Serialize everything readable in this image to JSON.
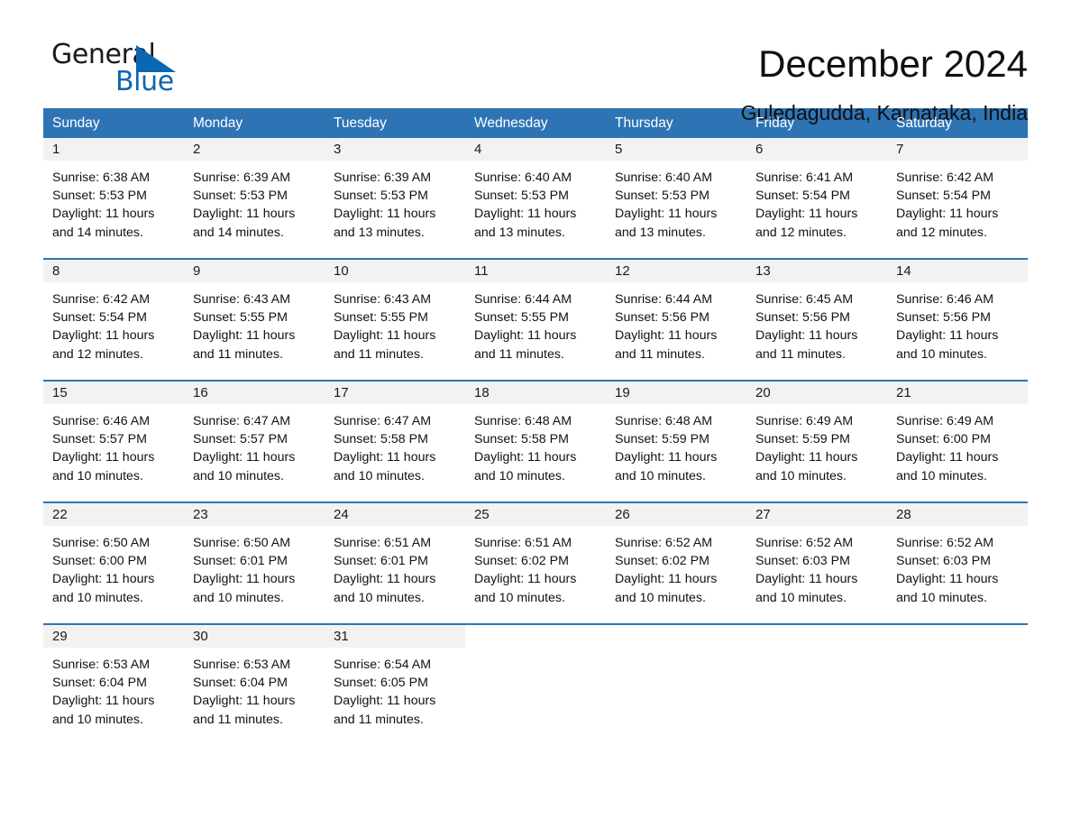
{
  "brand": {
    "name_part1": "General",
    "name_part2": "Blue",
    "accent_color": "#0b67b2",
    "triangle_icon": "triangle-icon"
  },
  "header": {
    "month_title": "December 2024",
    "location": "Guledagudda, Karnataka, India"
  },
  "calendar": {
    "header_bg": "#2e74b5",
    "daynum_band_bg": "#f2f2f2",
    "weekday_headers": [
      "Sunday",
      "Monday",
      "Tuesday",
      "Wednesday",
      "Thursday",
      "Friday",
      "Saturday"
    ],
    "weeks": [
      [
        {
          "day": "1",
          "sunrise": "Sunrise: 6:38 AM",
          "sunset": "Sunset: 5:53 PM",
          "daylight_line1": "Daylight: 11 hours",
          "daylight_line2": "and 14 minutes."
        },
        {
          "day": "2",
          "sunrise": "Sunrise: 6:39 AM",
          "sunset": "Sunset: 5:53 PM",
          "daylight_line1": "Daylight: 11 hours",
          "daylight_line2": "and 14 minutes."
        },
        {
          "day": "3",
          "sunrise": "Sunrise: 6:39 AM",
          "sunset": "Sunset: 5:53 PM",
          "daylight_line1": "Daylight: 11 hours",
          "daylight_line2": "and 13 minutes."
        },
        {
          "day": "4",
          "sunrise": "Sunrise: 6:40 AM",
          "sunset": "Sunset: 5:53 PM",
          "daylight_line1": "Daylight: 11 hours",
          "daylight_line2": "and 13 minutes."
        },
        {
          "day": "5",
          "sunrise": "Sunrise: 6:40 AM",
          "sunset": "Sunset: 5:53 PM",
          "daylight_line1": "Daylight: 11 hours",
          "daylight_line2": "and 13 minutes."
        },
        {
          "day": "6",
          "sunrise": "Sunrise: 6:41 AM",
          "sunset": "Sunset: 5:54 PM",
          "daylight_line1": "Daylight: 11 hours",
          "daylight_line2": "and 12 minutes."
        },
        {
          "day": "7",
          "sunrise": "Sunrise: 6:42 AM",
          "sunset": "Sunset: 5:54 PM",
          "daylight_line1": "Daylight: 11 hours",
          "daylight_line2": "and 12 minutes."
        }
      ],
      [
        {
          "day": "8",
          "sunrise": "Sunrise: 6:42 AM",
          "sunset": "Sunset: 5:54 PM",
          "daylight_line1": "Daylight: 11 hours",
          "daylight_line2": "and 12 minutes."
        },
        {
          "day": "9",
          "sunrise": "Sunrise: 6:43 AM",
          "sunset": "Sunset: 5:55 PM",
          "daylight_line1": "Daylight: 11 hours",
          "daylight_line2": "and 11 minutes."
        },
        {
          "day": "10",
          "sunrise": "Sunrise: 6:43 AM",
          "sunset": "Sunset: 5:55 PM",
          "daylight_line1": "Daylight: 11 hours",
          "daylight_line2": "and 11 minutes."
        },
        {
          "day": "11",
          "sunrise": "Sunrise: 6:44 AM",
          "sunset": "Sunset: 5:55 PM",
          "daylight_line1": "Daylight: 11 hours",
          "daylight_line2": "and 11 minutes."
        },
        {
          "day": "12",
          "sunrise": "Sunrise: 6:44 AM",
          "sunset": "Sunset: 5:56 PM",
          "daylight_line1": "Daylight: 11 hours",
          "daylight_line2": "and 11 minutes."
        },
        {
          "day": "13",
          "sunrise": "Sunrise: 6:45 AM",
          "sunset": "Sunset: 5:56 PM",
          "daylight_line1": "Daylight: 11 hours",
          "daylight_line2": "and 11 minutes."
        },
        {
          "day": "14",
          "sunrise": "Sunrise: 6:46 AM",
          "sunset": "Sunset: 5:56 PM",
          "daylight_line1": "Daylight: 11 hours",
          "daylight_line2": "and 10 minutes."
        }
      ],
      [
        {
          "day": "15",
          "sunrise": "Sunrise: 6:46 AM",
          "sunset": "Sunset: 5:57 PM",
          "daylight_line1": "Daylight: 11 hours",
          "daylight_line2": "and 10 minutes."
        },
        {
          "day": "16",
          "sunrise": "Sunrise: 6:47 AM",
          "sunset": "Sunset: 5:57 PM",
          "daylight_line1": "Daylight: 11 hours",
          "daylight_line2": "and 10 minutes."
        },
        {
          "day": "17",
          "sunrise": "Sunrise: 6:47 AM",
          "sunset": "Sunset: 5:58 PM",
          "daylight_line1": "Daylight: 11 hours",
          "daylight_line2": "and 10 minutes."
        },
        {
          "day": "18",
          "sunrise": "Sunrise: 6:48 AM",
          "sunset": "Sunset: 5:58 PM",
          "daylight_line1": "Daylight: 11 hours",
          "daylight_line2": "and 10 minutes."
        },
        {
          "day": "19",
          "sunrise": "Sunrise: 6:48 AM",
          "sunset": "Sunset: 5:59 PM",
          "daylight_line1": "Daylight: 11 hours",
          "daylight_line2": "and 10 minutes."
        },
        {
          "day": "20",
          "sunrise": "Sunrise: 6:49 AM",
          "sunset": "Sunset: 5:59 PM",
          "daylight_line1": "Daylight: 11 hours",
          "daylight_line2": "and 10 minutes."
        },
        {
          "day": "21",
          "sunrise": "Sunrise: 6:49 AM",
          "sunset": "Sunset: 6:00 PM",
          "daylight_line1": "Daylight: 11 hours",
          "daylight_line2": "and 10 minutes."
        }
      ],
      [
        {
          "day": "22",
          "sunrise": "Sunrise: 6:50 AM",
          "sunset": "Sunset: 6:00 PM",
          "daylight_line1": "Daylight: 11 hours",
          "daylight_line2": "and 10 minutes."
        },
        {
          "day": "23",
          "sunrise": "Sunrise: 6:50 AM",
          "sunset": "Sunset: 6:01 PM",
          "daylight_line1": "Daylight: 11 hours",
          "daylight_line2": "and 10 minutes."
        },
        {
          "day": "24",
          "sunrise": "Sunrise: 6:51 AM",
          "sunset": "Sunset: 6:01 PM",
          "daylight_line1": "Daylight: 11 hours",
          "daylight_line2": "and 10 minutes."
        },
        {
          "day": "25",
          "sunrise": "Sunrise: 6:51 AM",
          "sunset": "Sunset: 6:02 PM",
          "daylight_line1": "Daylight: 11 hours",
          "daylight_line2": "and 10 minutes."
        },
        {
          "day": "26",
          "sunrise": "Sunrise: 6:52 AM",
          "sunset": "Sunset: 6:02 PM",
          "daylight_line1": "Daylight: 11 hours",
          "daylight_line2": "and 10 minutes."
        },
        {
          "day": "27",
          "sunrise": "Sunrise: 6:52 AM",
          "sunset": "Sunset: 6:03 PM",
          "daylight_line1": "Daylight: 11 hours",
          "daylight_line2": "and 10 minutes."
        },
        {
          "day": "28",
          "sunrise": "Sunrise: 6:52 AM",
          "sunset": "Sunset: 6:03 PM",
          "daylight_line1": "Daylight: 11 hours",
          "daylight_line2": "and 10 minutes."
        }
      ],
      [
        {
          "day": "29",
          "sunrise": "Sunrise: 6:53 AM",
          "sunset": "Sunset: 6:04 PM",
          "daylight_line1": "Daylight: 11 hours",
          "daylight_line2": "and 10 minutes."
        },
        {
          "day": "30",
          "sunrise": "Sunrise: 6:53 AM",
          "sunset": "Sunset: 6:04 PM",
          "daylight_line1": "Daylight: 11 hours",
          "daylight_line2": "and 11 minutes."
        },
        {
          "day": "31",
          "sunrise": "Sunrise: 6:54 AM",
          "sunset": "Sunset: 6:05 PM",
          "daylight_line1": "Daylight: 11 hours",
          "daylight_line2": "and 11 minutes."
        },
        {
          "day": "",
          "sunrise": "",
          "sunset": "",
          "daylight_line1": "",
          "daylight_line2": ""
        },
        {
          "day": "",
          "sunrise": "",
          "sunset": "",
          "daylight_line1": "",
          "daylight_line2": ""
        },
        {
          "day": "",
          "sunrise": "",
          "sunset": "",
          "daylight_line1": "",
          "daylight_line2": ""
        },
        {
          "day": "",
          "sunrise": "",
          "sunset": "",
          "daylight_line1": "",
          "daylight_line2": ""
        }
      ]
    ]
  }
}
